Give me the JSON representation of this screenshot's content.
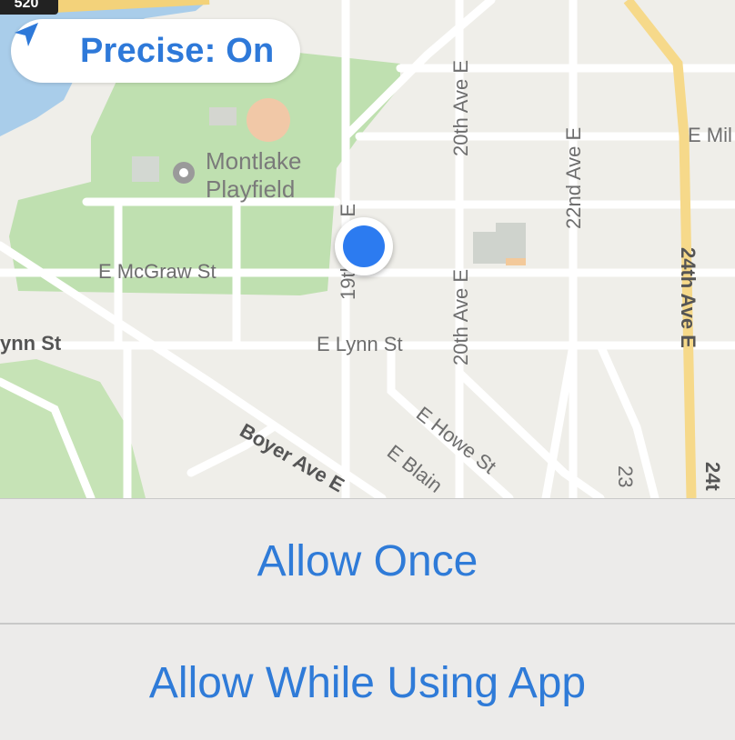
{
  "map": {
    "highway_badge": "520",
    "park_name_line1": "Montlake",
    "park_name_line2": "Playfield",
    "streets": {
      "e_mcgraw": "E McGraw St",
      "lynn_left": "ynn St",
      "e_lynn": "E Lynn St",
      "nineteenth": "19th Ave E",
      "twentieth_top": "20th Ave E",
      "twentieth_mid": "20th Ave E",
      "twenty_second": "22nd Ave E",
      "twenty_fourth": "24th Ave E",
      "twenty_third_partial": "23",
      "twenty_fourth_partial": "24t",
      "e_mil": "E Mil",
      "e_howe": "E Howe St",
      "e_blaine": "E Blain",
      "boyer": "Boyer Ave E"
    }
  },
  "precise_toggle": {
    "label": "Precise: On",
    "icon": "location-arrow-icon",
    "color": "#2e79d9"
  },
  "permission_sheet": {
    "allow_once": "Allow Once",
    "allow_while_using": "Allow While Using App",
    "accent": "#2f7bd8"
  }
}
